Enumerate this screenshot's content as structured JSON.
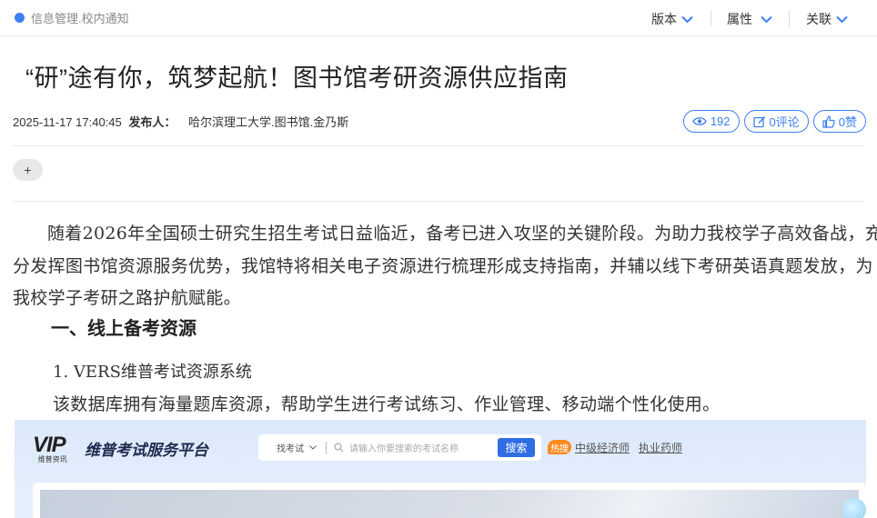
{
  "topbar": {
    "breadcrumb": "信息管理.校内通知",
    "menus": [
      {
        "label": "版本"
      },
      {
        "label": "属性"
      },
      {
        "label": "关联"
      }
    ]
  },
  "article": {
    "title": "“研”途有你，筑梦起航！图书馆考研资源供应指南",
    "date": "2025-11-17 17:40:45",
    "author_label": "发布人：",
    "author": "哈尔滨理工大学.图书馆.金乃斯",
    "views": "192",
    "comments": "0评论",
    "likes": "0赞",
    "add_label": "+",
    "intro": "随着2026年全国硕士研究生招生考试日益临近，备考已进入攻坚的关键阶段。为助力我校学子高效备战，充分发挥图书馆资源服务优势，我馆特将相关电子资源进行梳理形成支持指南，并辅以线下考研英语真题发放，为我校学子考研之路护航赋能。",
    "section1": "一、线上备考资源",
    "item1": "1. VERS维普考试资源系统",
    "item1_desc": "该数据库拥有海量题库资源，帮助学生进行考试练习、作业管理、移动端个性化使用。"
  },
  "embedded": {
    "logo_text": "VIP",
    "logo_sub": "维普资讯",
    "brand": "维普考试服务平台",
    "search_category": "找考试",
    "search_placeholder": "请输入你要搜索的考试名称",
    "search_button": "搜索",
    "hot_label": "热搜",
    "hot_links": [
      "中级经济师",
      "执业药师"
    ]
  },
  "colors": {
    "accent": "#3d7ff0",
    "search_button": "#2f6de3",
    "hot_badge": "#ff8a1f"
  }
}
